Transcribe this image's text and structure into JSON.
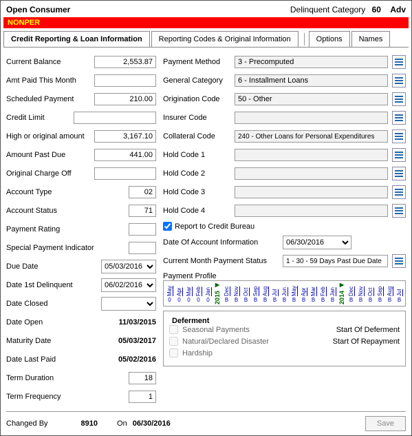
{
  "header": {
    "title": "Open Consumer",
    "delinq_label": "Delinquent Category",
    "delinq_value": "60",
    "adv": "Adv"
  },
  "redbar": "NONPER",
  "tabs": {
    "t1": "Credit Reporting & Loan Information",
    "t2": "Reporting Codes & Original Information",
    "t3": "Options",
    "t4": "Names"
  },
  "left": {
    "current_balance": {
      "label": "Current Balance",
      "value": "2,553.87"
    },
    "amt_paid": {
      "label": "Amt Paid This Month",
      "value": ""
    },
    "scheduled_payment": {
      "label": "Scheduled Payment",
      "value": "210.00"
    },
    "credit_limit": {
      "label": "Credit Limit",
      "value": ""
    },
    "high_original": {
      "label": "High or original amount",
      "value": "3,167.10"
    },
    "amount_past_due": {
      "label": "Amount Past Due",
      "value": "441.00"
    },
    "original_charge_off": {
      "label": "Original Charge Off",
      "value": ""
    },
    "account_type": {
      "label": "Account Type",
      "value": "02"
    },
    "account_status": {
      "label": "Account Status",
      "value": "71"
    },
    "payment_rating": {
      "label": "Payment Rating",
      "value": ""
    },
    "special_payment_indicator": {
      "label": "Special Payment Indicator",
      "value": ""
    },
    "due_date": {
      "label": "Due Date",
      "value": "05/03/2016"
    },
    "date_1st_delinq": {
      "label": "Date 1st Delinquent",
      "value": "06/02/2016"
    },
    "date_closed": {
      "label": "Date Closed",
      "value": ""
    },
    "date_open": {
      "label": "Date Open",
      "value": "11/03/2015"
    },
    "maturity_date": {
      "label": "Maturity Date",
      "value": "05/03/2017"
    },
    "date_last_paid": {
      "label": "Date Last Paid",
      "value": "05/02/2016"
    },
    "term_duration": {
      "label": "Term Duration",
      "value": "18"
    },
    "term_frequency": {
      "label": "Term Frequency",
      "value": "1"
    }
  },
  "right": {
    "payment_method": {
      "label": "Payment Method",
      "value": "3 - Precomputed"
    },
    "general_category": {
      "label": "General Category",
      "value": "6 - Installment Loans"
    },
    "origination_code": {
      "label": "Origination Code",
      "value": "50 - Other"
    },
    "insurer_code": {
      "label": "Insurer Code",
      "value": ""
    },
    "collateral_code": {
      "label": "Collateral Code",
      "value": "240 - Other Loans for Personal Expenditures"
    },
    "hold1": {
      "label": "Hold Code 1",
      "value": ""
    },
    "hold2": {
      "label": "Hold Code 2",
      "value": ""
    },
    "hold3": {
      "label": "Hold Code 3",
      "value": ""
    },
    "hold4": {
      "label": "Hold Code 4",
      "value": ""
    },
    "report_credit_bureau": "Report to Credit Bureau",
    "date_account_info": {
      "label": "Date Of Account Information",
      "value": "06/30/2016"
    },
    "current_month_status": {
      "label": "Current Month Payment Status",
      "value": "1 - 30 - 59 Days Past Due Date"
    },
    "payment_profile_label": "Payment Profile"
  },
  "profile": [
    {
      "mon": "May",
      "code": "0"
    },
    {
      "mon": "Apr",
      "code": "0"
    },
    {
      "mon": "Mar",
      "code": "0"
    },
    {
      "mon": "Feb",
      "code": "0"
    },
    {
      "mon": "Jan",
      "code": "0"
    },
    {
      "year": "2015"
    },
    {
      "mon": "Dec",
      "code": "B"
    },
    {
      "mon": "Nov",
      "code": "B"
    },
    {
      "mon": "Oct",
      "code": "B"
    },
    {
      "mon": "Sep",
      "code": "B"
    },
    {
      "mon": "Aug",
      "code": "B"
    },
    {
      "mon": "Jul",
      "code": "B"
    },
    {
      "mon": "Jun",
      "code": "B"
    },
    {
      "mon": "May",
      "code": "B"
    },
    {
      "mon": "Apr",
      "code": "B"
    },
    {
      "mon": "Mar",
      "code": "B"
    },
    {
      "mon": "Feb",
      "code": "B"
    },
    {
      "mon": "Jan",
      "code": "B"
    },
    {
      "year": "2014"
    },
    {
      "mon": "Dec",
      "code": "B"
    },
    {
      "mon": "Nov",
      "code": "B"
    },
    {
      "mon": "Oct",
      "code": "B"
    },
    {
      "mon": "Sep",
      "code": "B"
    },
    {
      "mon": "Aug",
      "code": "B"
    },
    {
      "mon": "Jul",
      "code": "B"
    }
  ],
  "deferment": {
    "title": "Deferment",
    "seasonal": "Seasonal Payments",
    "natural": "Natural/Declared Disaster",
    "hardship": "Hardship",
    "start_def": "Start Of Deferment",
    "start_rep": "Start Of Repayment"
  },
  "footer": {
    "changed_by_label": "Changed By",
    "changed_by_value": "8910",
    "on_label": "On",
    "on_value": "06/30/2016",
    "save": "Save"
  }
}
